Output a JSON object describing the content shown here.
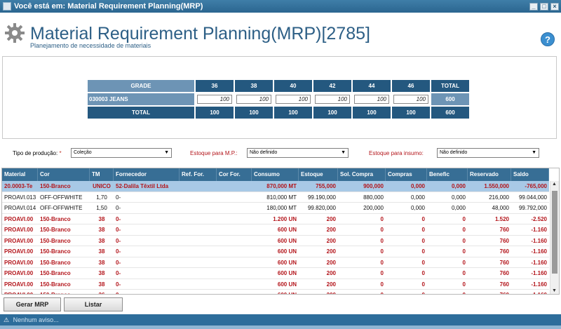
{
  "window": {
    "title": "Você está em: Material Requirement Planning(MRP)"
  },
  "header": {
    "title": "Material Requirement Planning(MRP)[2785]",
    "subtitle": "Planejamento de necessidade de materiais",
    "help_label": "?"
  },
  "grade": {
    "header_label": "GRADE",
    "sizes": [
      "36",
      "38",
      "40",
      "42",
      "44",
      "46"
    ],
    "total_label": "TOTAL",
    "item_label": "030003 JEANS",
    "item_values": [
      "100",
      "100",
      "100",
      "100",
      "100",
      "100"
    ],
    "item_total": "600",
    "footer_label": "TOTAL",
    "footer_values": [
      "100",
      "100",
      "100",
      "100",
      "100",
      "100"
    ],
    "footer_total": "600"
  },
  "filters": {
    "tipo_label": "Tipo de produção:",
    "tipo_required": "*",
    "tipo_value": "Coleção",
    "estoque_mp_label": "Estoque para M.P.:",
    "estoque_mp_value": "Não definido",
    "estoque_insumo_label": "Estoque para insumo:",
    "estoque_insumo_value": "Não definido"
  },
  "table": {
    "columns": [
      "Material",
      "Cor",
      "TM",
      "Fornecedor",
      "Ref. For.",
      "Cor For.",
      "Consumo",
      "Estoque",
      "Sol. Compra",
      "Compras",
      "Benefic",
      "Reservado",
      "Saldo"
    ],
    "rows": [
      {
        "style": "sel",
        "cells": [
          "20.0003-Te",
          "150-Branco",
          "UNICO",
          "52-Dalila Têxtil Ltda",
          "",
          "",
          "870,000 MT",
          "755,000",
          "900,000",
          "0,000",
          "0,000",
          "1.550,000",
          "-765,000"
        ]
      },
      {
        "style": "black",
        "cells": [
          "PROAVI.013",
          "OFF-OFFWHITE",
          "1,70",
          "0-",
          "",
          "",
          "810,000 MT",
          "99.190,000",
          "880,000",
          "0,000",
          "0,000",
          "216,000",
          "99.044,000"
        ]
      },
      {
        "style": "black",
        "cells": [
          "PROAVI.014",
          "OFF-OFFWHITE",
          "1,50",
          "0-",
          "",
          "",
          "180,000 MT",
          "99.820,000",
          "200,000",
          "0,000",
          "0,000",
          "48,000",
          "99.792,000"
        ]
      },
      {
        "style": "red",
        "cells": [
          "PROAVI.00",
          "150-Branco",
          "38",
          "0-",
          "",
          "",
          "1.200 UN",
          "200",
          "0",
          "0",
          "0",
          "1.520",
          "-2.520"
        ]
      },
      {
        "style": "red",
        "cells": [
          "PROAVI.00",
          "150-Branco",
          "38",
          "0-",
          "",
          "",
          "600 UN",
          "200",
          "0",
          "0",
          "0",
          "760",
          "-1.160"
        ]
      },
      {
        "style": "red",
        "cells": [
          "PROAVI.00",
          "150-Branco",
          "38",
          "0-",
          "",
          "",
          "600 UN",
          "200",
          "0",
          "0",
          "0",
          "760",
          "-1.160"
        ]
      },
      {
        "style": "red",
        "cells": [
          "PROAVI.00",
          "150-Branco",
          "38",
          "0-",
          "",
          "",
          "600 UN",
          "200",
          "0",
          "0",
          "0",
          "760",
          "-1.160"
        ]
      },
      {
        "style": "red",
        "cells": [
          "PROAVI.00",
          "150-Branco",
          "38",
          "0-",
          "",
          "",
          "600 UN",
          "200",
          "0",
          "0",
          "0",
          "760",
          "-1.160"
        ]
      },
      {
        "style": "red",
        "cells": [
          "PROAVI.00",
          "150-Branco",
          "38",
          "0-",
          "",
          "",
          "600 UN",
          "200",
          "0",
          "0",
          "0",
          "760",
          "-1.160"
        ]
      },
      {
        "style": "red",
        "cells": [
          "PROAVI.00",
          "150-Branco",
          "38",
          "0-",
          "",
          "",
          "600 UN",
          "200",
          "0",
          "0",
          "0",
          "760",
          "-1.160"
        ]
      },
      {
        "style": "red",
        "cells": [
          "PROAVI.00",
          "150-Branco",
          "36",
          "0-",
          "",
          "",
          "600 UN",
          "200",
          "0",
          "0",
          "0",
          "760",
          "-1.160"
        ]
      },
      {
        "style": "red",
        "cells": [
          "PROAVI.00",
          "150-Branco",
          "38",
          "0-",
          "",
          "",
          "600 UN",
          "200",
          "0",
          "0",
          "0",
          "760",
          "-1.160"
        ]
      }
    ]
  },
  "buttons": {
    "gerar": "Gerar MRP",
    "listar": "Listar"
  },
  "status": {
    "message": "Nenhum aviso..."
  }
}
